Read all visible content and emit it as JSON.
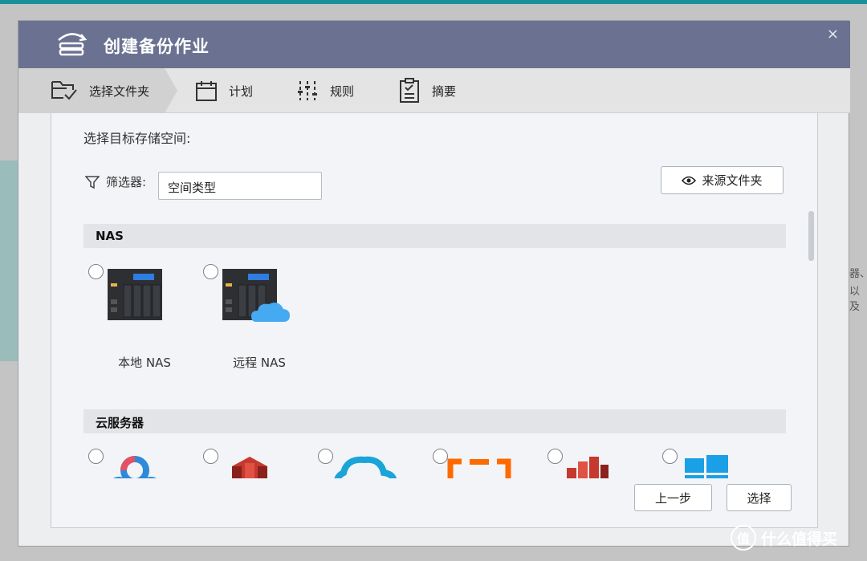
{
  "window": {
    "title": "创建备份作业",
    "close_label": "×"
  },
  "steps": [
    {
      "label": "选择文件夹",
      "icon": "folder-check-icon",
      "active": true
    },
    {
      "label": "计划",
      "icon": "calendar-icon",
      "active": false
    },
    {
      "label": "规则",
      "icon": "sliders-icon",
      "active": false
    },
    {
      "label": "摘要",
      "icon": "clipboard-icon",
      "active": false
    }
  ],
  "content": {
    "prompt": "选择目标存储空间:",
    "filter_label": "筛选器:",
    "filter_value": "空间类型",
    "source_folder_button": "来源文件夹"
  },
  "sections": {
    "nas": {
      "title": "NAS",
      "options": [
        {
          "label": "本地 NAS",
          "icon": "nas-device-icon"
        },
        {
          "label": "远程 NAS",
          "icon": "remote-nas-cloud-icon"
        }
      ]
    },
    "cloud": {
      "title": "云服务器",
      "options": [
        {
          "icon": "baidu-cloud-icon"
        },
        {
          "icon": "amazon-s3-icon"
        },
        {
          "icon": "cloud-outline-icon"
        },
        {
          "icon": "aliyun-icon"
        },
        {
          "icon": "aws-glacier-icon"
        },
        {
          "icon": "windows-azure-icon"
        }
      ]
    }
  },
  "footer": {
    "back_label": "上一步",
    "select_label": "选择"
  },
  "background": {
    "right_text_1": "器、",
    "right_text_2": "以及"
  },
  "watermark": {
    "icon_text": "值",
    "text": "什么值得买"
  },
  "colors": {
    "titlebar": "#6b7291",
    "accent_cyan": "#1b8f9a"
  }
}
